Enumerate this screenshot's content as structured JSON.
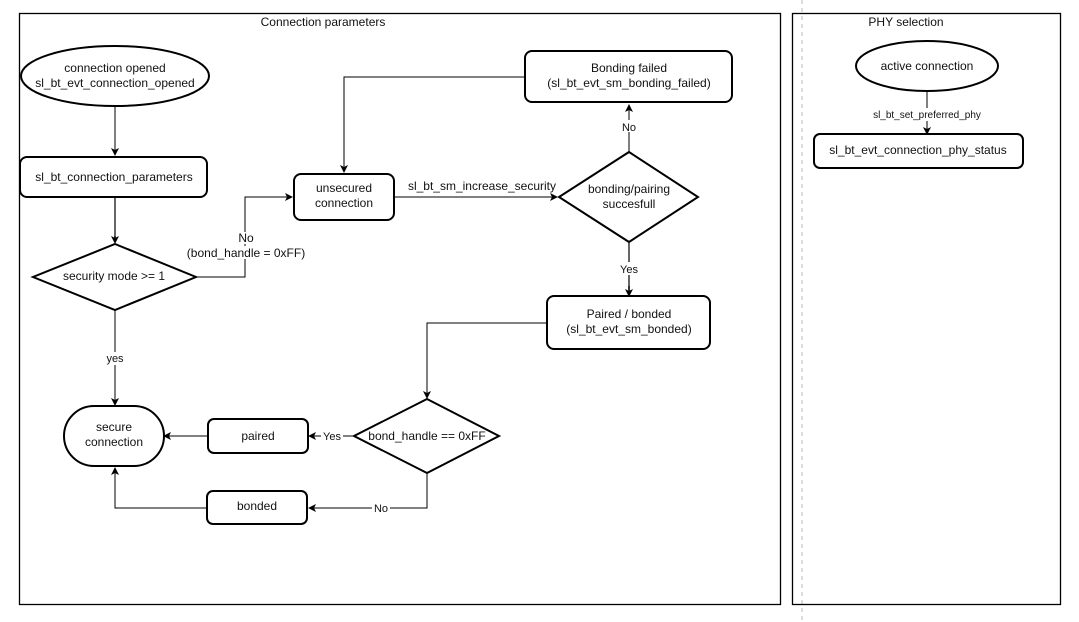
{
  "panels": {
    "connection_parameters": {
      "title": "Connection parameters"
    },
    "phy_selection": {
      "title": "PHY selection"
    }
  },
  "nodes": {
    "connection_opened": {
      "line1": "connection opened",
      "line2": "sl_bt_evt_connection_opened"
    },
    "connection_parameters": {
      "label": "sl_bt_connection_parameters"
    },
    "security_mode": {
      "label": "security mode >= 1"
    },
    "unsecured_connection": {
      "line1": "unsecured",
      "line2": "connection"
    },
    "bonding_failed": {
      "line1": "Bonding failed",
      "line2": "(sl_bt_evt_sm_bonding_failed)"
    },
    "bonding_pairing": {
      "line1": "bonding/pairing",
      "line2": "succesfull"
    },
    "paired_bonded": {
      "line1": "Paired / bonded",
      "line2": "(sl_bt_evt_sm_bonded)"
    },
    "bond_handle_check": {
      "label": "bond_handle == 0xFF"
    },
    "paired": {
      "label": "paired"
    },
    "bonded": {
      "label": "bonded"
    },
    "secure_connection": {
      "line1": "secure",
      "line2": "connection"
    },
    "active_connection": {
      "label": "active connection"
    },
    "phy_status": {
      "label": "sl_bt_evt_connection_phy_status"
    }
  },
  "edges": {
    "security_no": {
      "line1": "No",
      "line2": "(bond_handle = 0xFF)"
    },
    "security_yes": {
      "label": "yes"
    },
    "increase_security": {
      "label": "sl_bt_sm_increase_security"
    },
    "bonding_no": {
      "label": "No"
    },
    "bonding_yes": {
      "label": "Yes"
    },
    "bond_handle_yes": {
      "label": "Yes"
    },
    "bond_handle_no": {
      "label": "No"
    },
    "set_preferred_phy": {
      "label": "sl_bt_set_preferred_phy"
    }
  }
}
